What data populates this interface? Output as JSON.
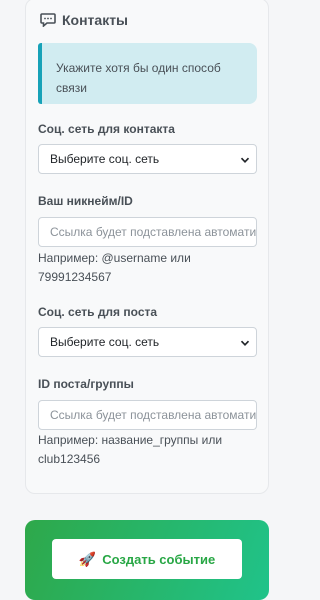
{
  "contacts": {
    "title": "Контакты",
    "alert_text": "Укажите хотя бы один способ связи",
    "social_contact": {
      "label": "Соц. сеть для контакта",
      "selected": "Выберите соц. сеть"
    },
    "nickname": {
      "label": "Ваш никнейм/ID",
      "placeholder": "Ссылка будет подставлена автоматически",
      "hint": "Например: @username или 79991234567"
    },
    "social_post": {
      "label": "Соц. сеть для поста",
      "selected": "Выберите соц. сеть"
    },
    "post_id": {
      "label": "ID поста/группы",
      "placeholder": "Ссылка будет подставлена автоматически",
      "hint": "Например: название_группы или club123456"
    }
  },
  "submit": {
    "icon": "🚀",
    "label": "Создать событие"
  }
}
